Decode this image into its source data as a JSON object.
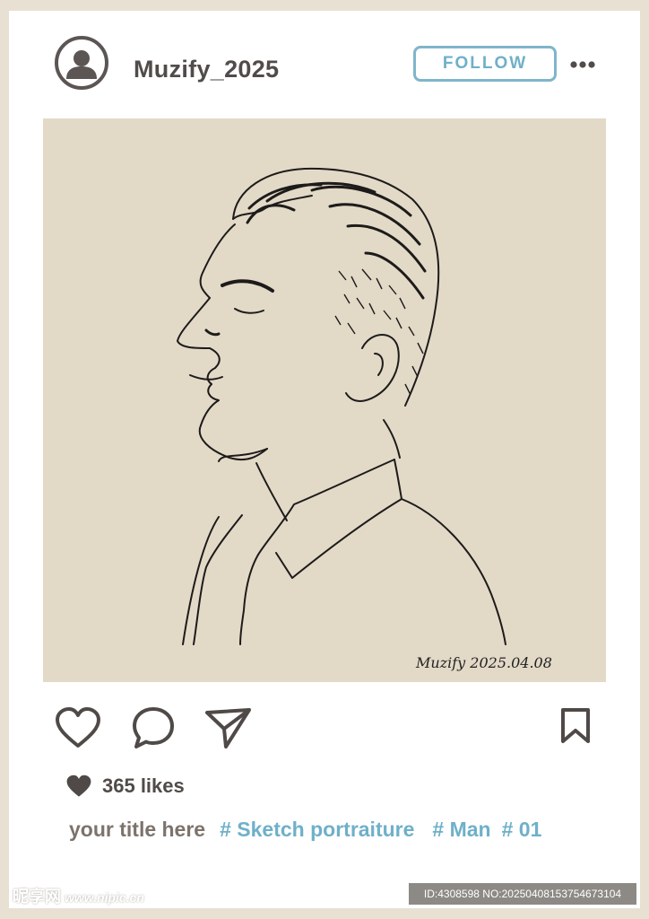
{
  "post": {
    "username": "Muzify_2025",
    "follow_label": "FOLLOW",
    "more_icon": "more-dots-icon",
    "photo": {
      "signature": "Muzify 2025.04.08",
      "background_color": "#e2d9c7"
    },
    "actions": {
      "like_icon": "heart-outline-icon",
      "comment_icon": "comment-bubble-icon",
      "share_icon": "paper-plane-icon",
      "save_icon": "bookmark-icon"
    },
    "likes_text": "365 likes",
    "caption": {
      "title": "your title here",
      "tags": [
        "# Sketch portraiture",
        "# Man",
        "# 01"
      ]
    }
  },
  "footer": {
    "watermark": "昵享网",
    "watermark_domain": "www.nipic.cn",
    "id_text": "ID:4308598 NO:20250408153754673104"
  },
  "colors": {
    "accent": "#6fb0c9",
    "text_dark": "#514b49",
    "frame": "#e7e0d3"
  }
}
